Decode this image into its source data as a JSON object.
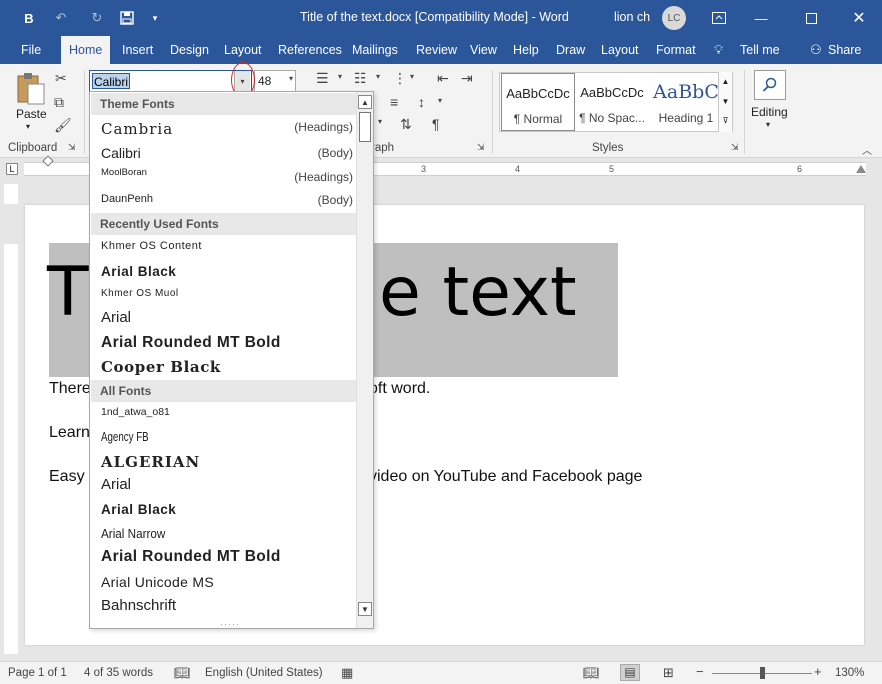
{
  "window": {
    "title": "Title of the text.docx [Compatibility Mode]  -  Word",
    "user": "lion ch",
    "avatar_initials": "LC"
  },
  "quick_access": {
    "app_icon": "B"
  },
  "tabs": [
    "File",
    "Home",
    "Insert",
    "Design",
    "Layout",
    "References",
    "Mailings",
    "Review",
    "View",
    "Help",
    "Draw",
    "Layout",
    "Format"
  ],
  "tell_me": "Tell me",
  "share": "Share",
  "ribbon": {
    "paste_label": "Paste",
    "clipboard_label": "Clipboard",
    "paragraph_label": "raph",
    "styles_label": "Styles",
    "editing_label": "Editing",
    "font_name": "Calibri",
    "font_size": "48",
    "styles": [
      {
        "preview": "AaBbCcDc",
        "name": "¶ Normal"
      },
      {
        "preview": "AaBbCcDc",
        "name": "¶ No Spac..."
      },
      {
        "preview": "AaBbC",
        "name": "Heading 1"
      }
    ]
  },
  "ruler": {
    "numbers": [
      "1",
      "2",
      "3",
      "4",
      "5",
      "6"
    ]
  },
  "font_dropdown": {
    "sections": [
      {
        "header": "Theme Fonts",
        "items": [
          {
            "name": "Cambria",
            "hint": "(Headings)"
          },
          {
            "name": "Calibri",
            "hint": "(Body)"
          },
          {
            "name": "MoolBoran",
            "hint": "(Headings)"
          },
          {
            "name": "DaunPenh",
            "hint": "(Body)"
          }
        ]
      },
      {
        "header": "Recently Used Fonts",
        "items": [
          {
            "name": "Khmer OS Content"
          },
          {
            "name": "Arial Black"
          },
          {
            "name": "Khmer OS Muol"
          },
          {
            "name": "Arial"
          },
          {
            "name": "Arial Rounded MT Bold"
          },
          {
            "name": "Cooper Black"
          }
        ]
      },
      {
        "header": "All Fonts",
        "items": [
          {
            "name": "1nd_atwa_o81"
          },
          {
            "name": "Agency FB"
          },
          {
            "name": "ALGERIAN"
          },
          {
            "name": "Arial"
          },
          {
            "name": "Arial Black"
          },
          {
            "name": "Arial Narrow"
          },
          {
            "name": "Arial Rounded MT Bold"
          },
          {
            "name": "Arial Unicode MS"
          },
          {
            "name": "Bahnschrift"
          }
        ]
      }
    ]
  },
  "document": {
    "title_left": "T",
    "title_right": "e text",
    "lines": [
      "There",
      "oft word.",
      "Learn",
      "Easy",
      "video on YouTube and Facebook page"
    ]
  },
  "status": {
    "page": "Page 1 of 1",
    "words": "4 of 35 words",
    "language": "English (United States)",
    "zoom": "130%"
  },
  "colors": {
    "accent": "#2b579a",
    "highlight": "#bfbfbf",
    "annotation": "#d32a2a"
  }
}
